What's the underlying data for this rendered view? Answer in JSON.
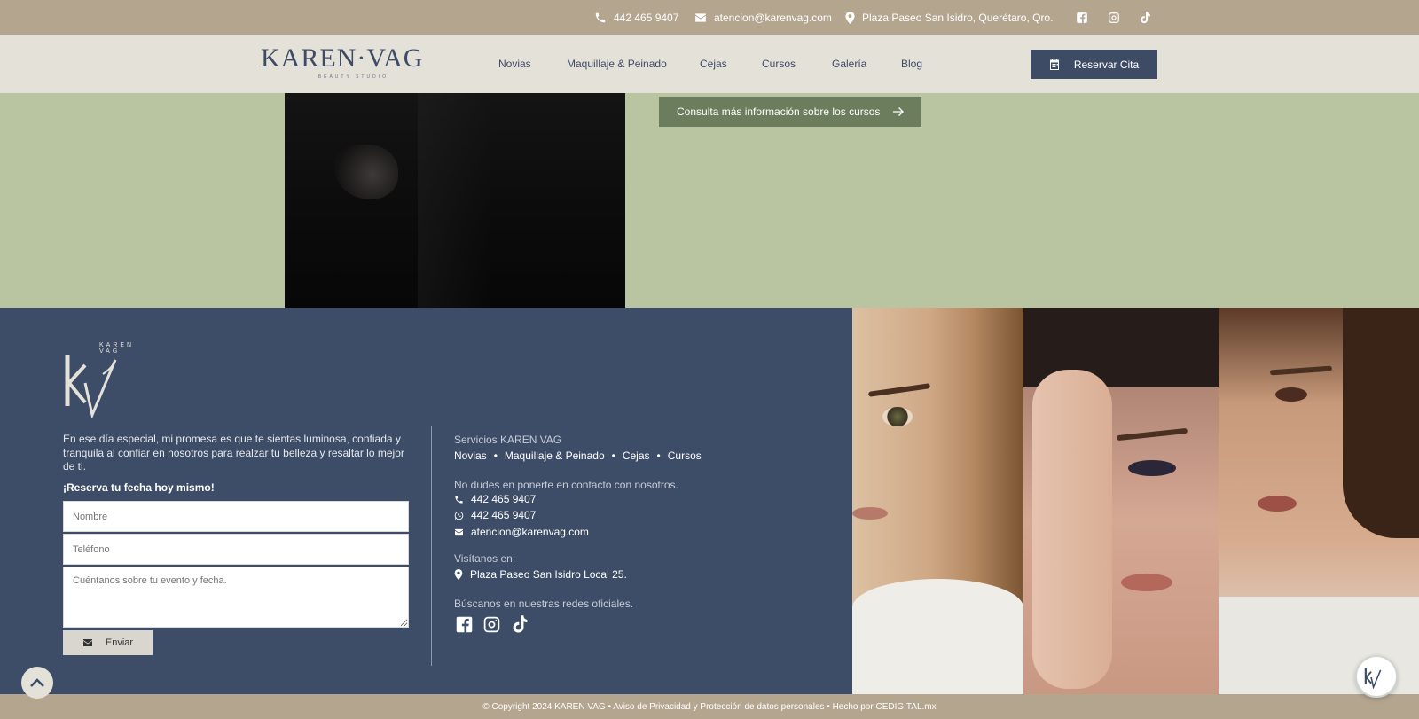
{
  "topbar": {
    "phone": "442 465 9407",
    "email": "atencion@karenvag.com",
    "address": "Plaza Paseo San Isidro, Querétaro, Qro.",
    "social_icons": [
      "facebook-icon",
      "instagram-icon",
      "tiktok-icon"
    ]
  },
  "nav": {
    "logo_text": "KAREN·VAG",
    "logo_sub": "BEAUTY STUDIO",
    "menu": [
      "Novias",
      "Maquillaje & Peinado",
      "Cejas",
      "Cursos",
      "Galería",
      "Blog"
    ],
    "reserve_label": "Reservar Cita"
  },
  "content": {
    "courses_button": "Consulta más información sobre los cursos"
  },
  "footer": {
    "logo_text": "KAREN VAG",
    "intro": "En ese día especial, mi promesa es que te sientas luminosa, confiada y tranquila al confiar en nosotros para realzar tu belleza y resaltar lo mejor de ti.",
    "cta": "¡Reserva tu fecha hoy mismo!",
    "form": {
      "name_placeholder": "Nombre",
      "phone_placeholder": "Teléfono",
      "message_placeholder": "Cuéntanos sobre tu evento y fecha.",
      "send_label": "Enviar"
    },
    "services_label": "Servicios KAREN VAG",
    "services": [
      "Novias",
      "Maquillaje & Peinado",
      "Cejas",
      "Cursos"
    ],
    "contact_label": "No dudes en ponerte en contacto con nosotros.",
    "phone": "442 465 9407",
    "whatsapp": "442 465 9407",
    "email": "atencion@karenvag.com",
    "visit_label": "Visítanos en:",
    "address": "Plaza Paseo San Isidro Local 25.",
    "social_label": "Búscanos en nuestras redes oficiales.",
    "social_icons": [
      "facebook-icon",
      "instagram-icon",
      "tiktok-icon"
    ]
  },
  "copyright": "© Copyright 2024 KAREN VAG • Aviso de Privacidad y Protección de datos personales • Hecho por CEDIGITAL.mx",
  "colors": {
    "topbar": "#b4a58f",
    "nav": "#e4e1d9",
    "navy": "#3e4d67",
    "sage": "#b9c5a0",
    "olive": "#6b7d5c"
  }
}
